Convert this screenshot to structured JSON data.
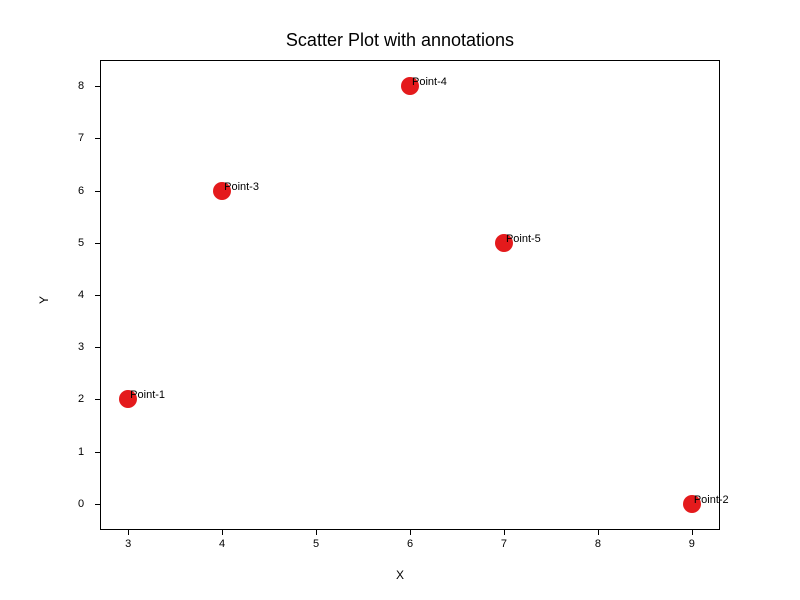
{
  "chart_data": {
    "type": "scatter",
    "title": "Scatter Plot with annotations",
    "xlabel": "X",
    "ylabel": "Y",
    "xlim": [
      2.7,
      9.3
    ],
    "ylim": [
      -0.5,
      8.5
    ],
    "x_ticks": [
      3,
      4,
      5,
      6,
      7,
      8,
      9
    ],
    "y_ticks": [
      0,
      1,
      2,
      3,
      4,
      5,
      6,
      7,
      8
    ],
    "points": [
      {
        "x": 3,
        "y": 2,
        "label": "Point-1"
      },
      {
        "x": 9,
        "y": 0,
        "label": "Point-2"
      },
      {
        "x": 4,
        "y": 6,
        "label": "Point-3"
      },
      {
        "x": 6,
        "y": 8,
        "label": "Point-4"
      },
      {
        "x": 7,
        "y": 5,
        "label": "Point-5"
      }
    ],
    "marker_color": "#e41a1c"
  }
}
